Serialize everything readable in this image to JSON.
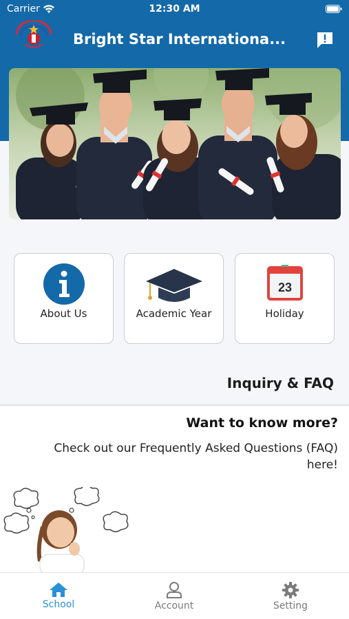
{
  "status_bar": {
    "carrier": "Carrier",
    "time": "12:30 AM"
  },
  "header": {
    "title": "Bright Star Internationa...",
    "background_color": "#1469a8",
    "logo_icon": "school-logo-icon",
    "action_icon": "feedback-icon"
  },
  "banner": {
    "image": "graduates-photo"
  },
  "tiles": [
    {
      "label": "About Us",
      "icon": "info-icon"
    },
    {
      "label": "Academic Year",
      "icon": "graduation-cap-icon"
    },
    {
      "label": "Holiday",
      "icon": "calendar-icon",
      "calendar_day": "23"
    }
  ],
  "inquiry": {
    "section_title": "Inquiry & FAQ",
    "headline": "Want to know more?",
    "text": "Check out our Frequently Asked Questions (FAQ) here!"
  },
  "tabbar": {
    "tabs": [
      {
        "label": "School",
        "icon": "home-icon",
        "active": true
      },
      {
        "label": "Account",
        "icon": "user-icon",
        "active": false
      },
      {
        "label": "Setting",
        "icon": "gear-icon",
        "active": false
      }
    ],
    "active_color": "#2a8fd8",
    "inactive_color": "#7a7a7a"
  }
}
